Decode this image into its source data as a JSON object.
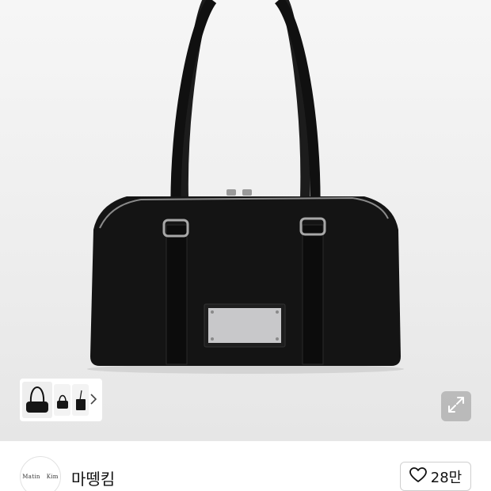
{
  "product": {
    "image_alt": "black shoulder bag",
    "brand_name": "마뗑킴",
    "logo_text_left": "Matin",
    "logo_text_right": "Kim"
  },
  "gallery": {
    "thumbnail_count": 3,
    "next_icon": "chevron-right-icon",
    "expand_icon": "expand-icon"
  },
  "actions": {
    "like_icon": "heart-outline-icon",
    "like_count": "28만"
  },
  "colors": {
    "bag": "#141414",
    "hero_background": "#eeeeee",
    "plate": "#c8c8ca"
  }
}
